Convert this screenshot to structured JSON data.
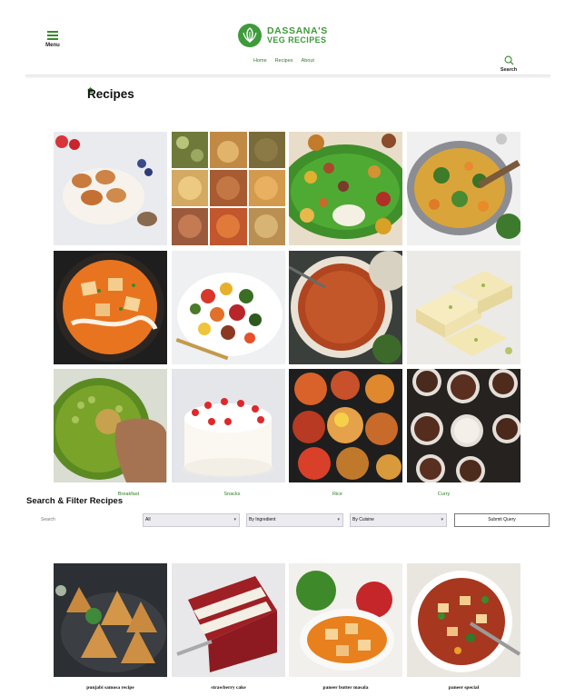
{
  "header": {
    "menu_label": "Menu",
    "logo_line1": "DASSANA'S",
    "logo_line2": "VEG RECIPES",
    "nav": [
      "Home",
      "Recipes",
      "About"
    ],
    "search_label": "Search",
    "brand_color": "#3e9a3a"
  },
  "page": {
    "title": "Recipes"
  },
  "categories": [
    {
      "label": "Breakfast"
    },
    {
      "label": "Snacks"
    },
    {
      "label": "Rice"
    },
    {
      "label": "Curry"
    }
  ],
  "filter": {
    "title": "Search & Filter Recipes",
    "search_placeholder": "Search",
    "select_all": "All",
    "select_ingredient": "By Ingredient",
    "select_cuisine": "By Cuisine",
    "submit_label": "Submit Query"
  },
  "recipes": [
    {
      "title": "punjabi samosa recipe"
    },
    {
      "title": "strawberry cake"
    },
    {
      "title": "paneer butter masala"
    },
    {
      "title": "paneer special"
    }
  ]
}
